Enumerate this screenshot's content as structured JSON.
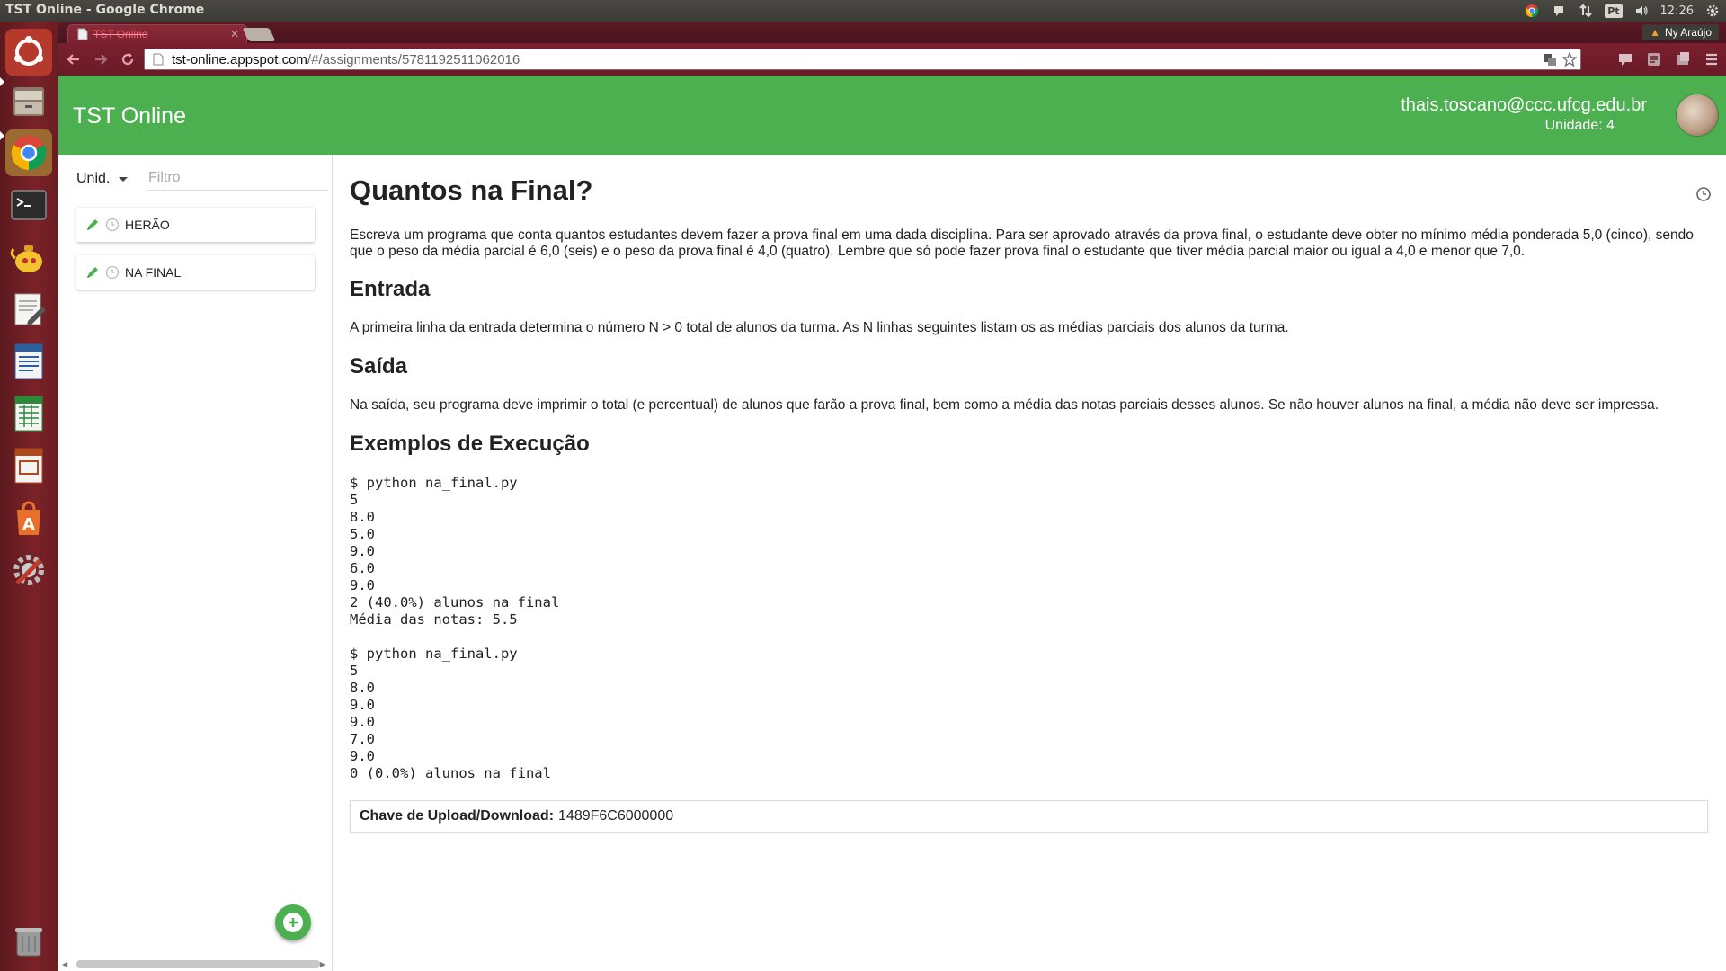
{
  "os": {
    "window_title": "TST Online - Google Chrome",
    "clock": "12:26",
    "lang_indicator": "Pt"
  },
  "browser": {
    "tab_title": "TST Online",
    "user_badge": "Ny Araújo",
    "url_host": "tst-online.appspot.com",
    "url_path": "/#/assignments/5781192511062016"
  },
  "app": {
    "title": "TST Online",
    "user_email": "thais.toscano@ccc.ufcg.edu.br",
    "user_unit": "Unidade: 4"
  },
  "sidebar": {
    "unit_select": "Unid.",
    "filter_placeholder": "Filtro",
    "items": [
      {
        "label": "HERÃO"
      },
      {
        "label": "NA FINAL"
      }
    ]
  },
  "assignment": {
    "title": "Quantos na Final?",
    "description": "Escreva um programa que conta quantos estudantes devem fazer a prova final em uma dada disciplina. Para ser aprovado através da prova final, o estudante deve obter no mínimo média ponderada 5,0 (cinco), sendo que o peso da média parcial é 6,0 (seis) e o peso da prova final é 4,0 (quatro). Lembre que só pode fazer prova final o estudante que tiver média parcial maior ou igual a 4,0 e menor que 7,0.",
    "input_heading": "Entrada",
    "input_text": "A primeira linha da entrada determina o número N > 0 total de alunos da turma. As N linhas seguintes listam os as médias parciais dos alunos da turma.",
    "output_heading": "Saída",
    "output_text": "Na saída, seu programa deve imprimir o total (e percentual) de alunos que farão a prova final, bem como a média das notas parciais desses alunos. Se não houver alunos na final, a média não deve ser impressa.",
    "examples_heading": "Exemplos de Execução",
    "example1": "$ python na_final.py\n5\n8.0\n5.0\n9.0\n6.0\n9.0\n2 (40.0%) alunos na final\nMédia das notas: 5.5",
    "example2": "$ python na_final.py\n5\n8.0\n9.0\n9.0\n7.0\n9.0\n0 (0.0%) alunos na final",
    "upload_label": "Chave de Upload/Download:",
    "upload_key": "1489F6C6000000"
  }
}
